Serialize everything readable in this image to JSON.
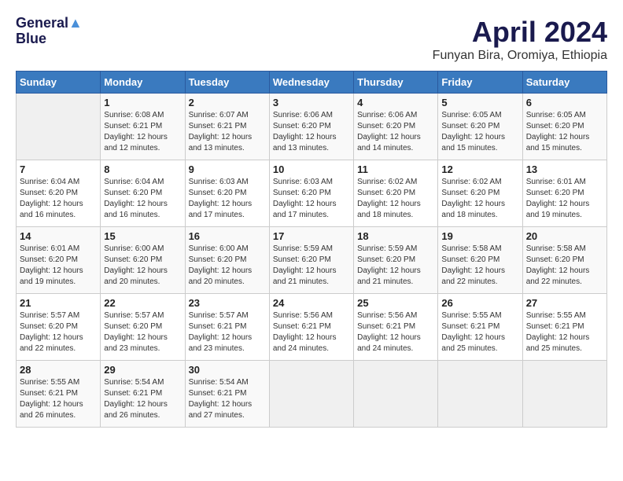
{
  "header": {
    "logo_line1": "General",
    "logo_line2": "Blue",
    "main_title": "April 2024",
    "subtitle": "Funyan Bira, Oromiya, Ethiopia"
  },
  "calendar": {
    "days_of_week": [
      "Sunday",
      "Monday",
      "Tuesday",
      "Wednesday",
      "Thursday",
      "Friday",
      "Saturday"
    ],
    "weeks": [
      [
        {
          "day": "",
          "info": ""
        },
        {
          "day": "1",
          "info": "Sunrise: 6:08 AM\nSunset: 6:21 PM\nDaylight: 12 hours\nand 12 minutes."
        },
        {
          "day": "2",
          "info": "Sunrise: 6:07 AM\nSunset: 6:21 PM\nDaylight: 12 hours\nand 13 minutes."
        },
        {
          "day": "3",
          "info": "Sunrise: 6:06 AM\nSunset: 6:20 PM\nDaylight: 12 hours\nand 13 minutes."
        },
        {
          "day": "4",
          "info": "Sunrise: 6:06 AM\nSunset: 6:20 PM\nDaylight: 12 hours\nand 14 minutes."
        },
        {
          "day": "5",
          "info": "Sunrise: 6:05 AM\nSunset: 6:20 PM\nDaylight: 12 hours\nand 15 minutes."
        },
        {
          "day": "6",
          "info": "Sunrise: 6:05 AM\nSunset: 6:20 PM\nDaylight: 12 hours\nand 15 minutes."
        }
      ],
      [
        {
          "day": "7",
          "info": "Sunrise: 6:04 AM\nSunset: 6:20 PM\nDaylight: 12 hours\nand 16 minutes."
        },
        {
          "day": "8",
          "info": "Sunrise: 6:04 AM\nSunset: 6:20 PM\nDaylight: 12 hours\nand 16 minutes."
        },
        {
          "day": "9",
          "info": "Sunrise: 6:03 AM\nSunset: 6:20 PM\nDaylight: 12 hours\nand 17 minutes."
        },
        {
          "day": "10",
          "info": "Sunrise: 6:03 AM\nSunset: 6:20 PM\nDaylight: 12 hours\nand 17 minutes."
        },
        {
          "day": "11",
          "info": "Sunrise: 6:02 AM\nSunset: 6:20 PM\nDaylight: 12 hours\nand 18 minutes."
        },
        {
          "day": "12",
          "info": "Sunrise: 6:02 AM\nSunset: 6:20 PM\nDaylight: 12 hours\nand 18 minutes."
        },
        {
          "day": "13",
          "info": "Sunrise: 6:01 AM\nSunset: 6:20 PM\nDaylight: 12 hours\nand 19 minutes."
        }
      ],
      [
        {
          "day": "14",
          "info": "Sunrise: 6:01 AM\nSunset: 6:20 PM\nDaylight: 12 hours\nand 19 minutes."
        },
        {
          "day": "15",
          "info": "Sunrise: 6:00 AM\nSunset: 6:20 PM\nDaylight: 12 hours\nand 20 minutes."
        },
        {
          "day": "16",
          "info": "Sunrise: 6:00 AM\nSunset: 6:20 PM\nDaylight: 12 hours\nand 20 minutes."
        },
        {
          "day": "17",
          "info": "Sunrise: 5:59 AM\nSunset: 6:20 PM\nDaylight: 12 hours\nand 21 minutes."
        },
        {
          "day": "18",
          "info": "Sunrise: 5:59 AM\nSunset: 6:20 PM\nDaylight: 12 hours\nand 21 minutes."
        },
        {
          "day": "19",
          "info": "Sunrise: 5:58 AM\nSunset: 6:20 PM\nDaylight: 12 hours\nand 22 minutes."
        },
        {
          "day": "20",
          "info": "Sunrise: 5:58 AM\nSunset: 6:20 PM\nDaylight: 12 hours\nand 22 minutes."
        }
      ],
      [
        {
          "day": "21",
          "info": "Sunrise: 5:57 AM\nSunset: 6:20 PM\nDaylight: 12 hours\nand 22 minutes."
        },
        {
          "day": "22",
          "info": "Sunrise: 5:57 AM\nSunset: 6:20 PM\nDaylight: 12 hours\nand 23 minutes."
        },
        {
          "day": "23",
          "info": "Sunrise: 5:57 AM\nSunset: 6:21 PM\nDaylight: 12 hours\nand 23 minutes."
        },
        {
          "day": "24",
          "info": "Sunrise: 5:56 AM\nSunset: 6:21 PM\nDaylight: 12 hours\nand 24 minutes."
        },
        {
          "day": "25",
          "info": "Sunrise: 5:56 AM\nSunset: 6:21 PM\nDaylight: 12 hours\nand 24 minutes."
        },
        {
          "day": "26",
          "info": "Sunrise: 5:55 AM\nSunset: 6:21 PM\nDaylight: 12 hours\nand 25 minutes."
        },
        {
          "day": "27",
          "info": "Sunrise: 5:55 AM\nSunset: 6:21 PM\nDaylight: 12 hours\nand 25 minutes."
        }
      ],
      [
        {
          "day": "28",
          "info": "Sunrise: 5:55 AM\nSunset: 6:21 PM\nDaylight: 12 hours\nand 26 minutes."
        },
        {
          "day": "29",
          "info": "Sunrise: 5:54 AM\nSunset: 6:21 PM\nDaylight: 12 hours\nand 26 minutes."
        },
        {
          "day": "30",
          "info": "Sunrise: 5:54 AM\nSunset: 6:21 PM\nDaylight: 12 hours\nand 27 minutes."
        },
        {
          "day": "",
          "info": ""
        },
        {
          "day": "",
          "info": ""
        },
        {
          "day": "",
          "info": ""
        },
        {
          "day": "",
          "info": ""
        }
      ]
    ]
  }
}
